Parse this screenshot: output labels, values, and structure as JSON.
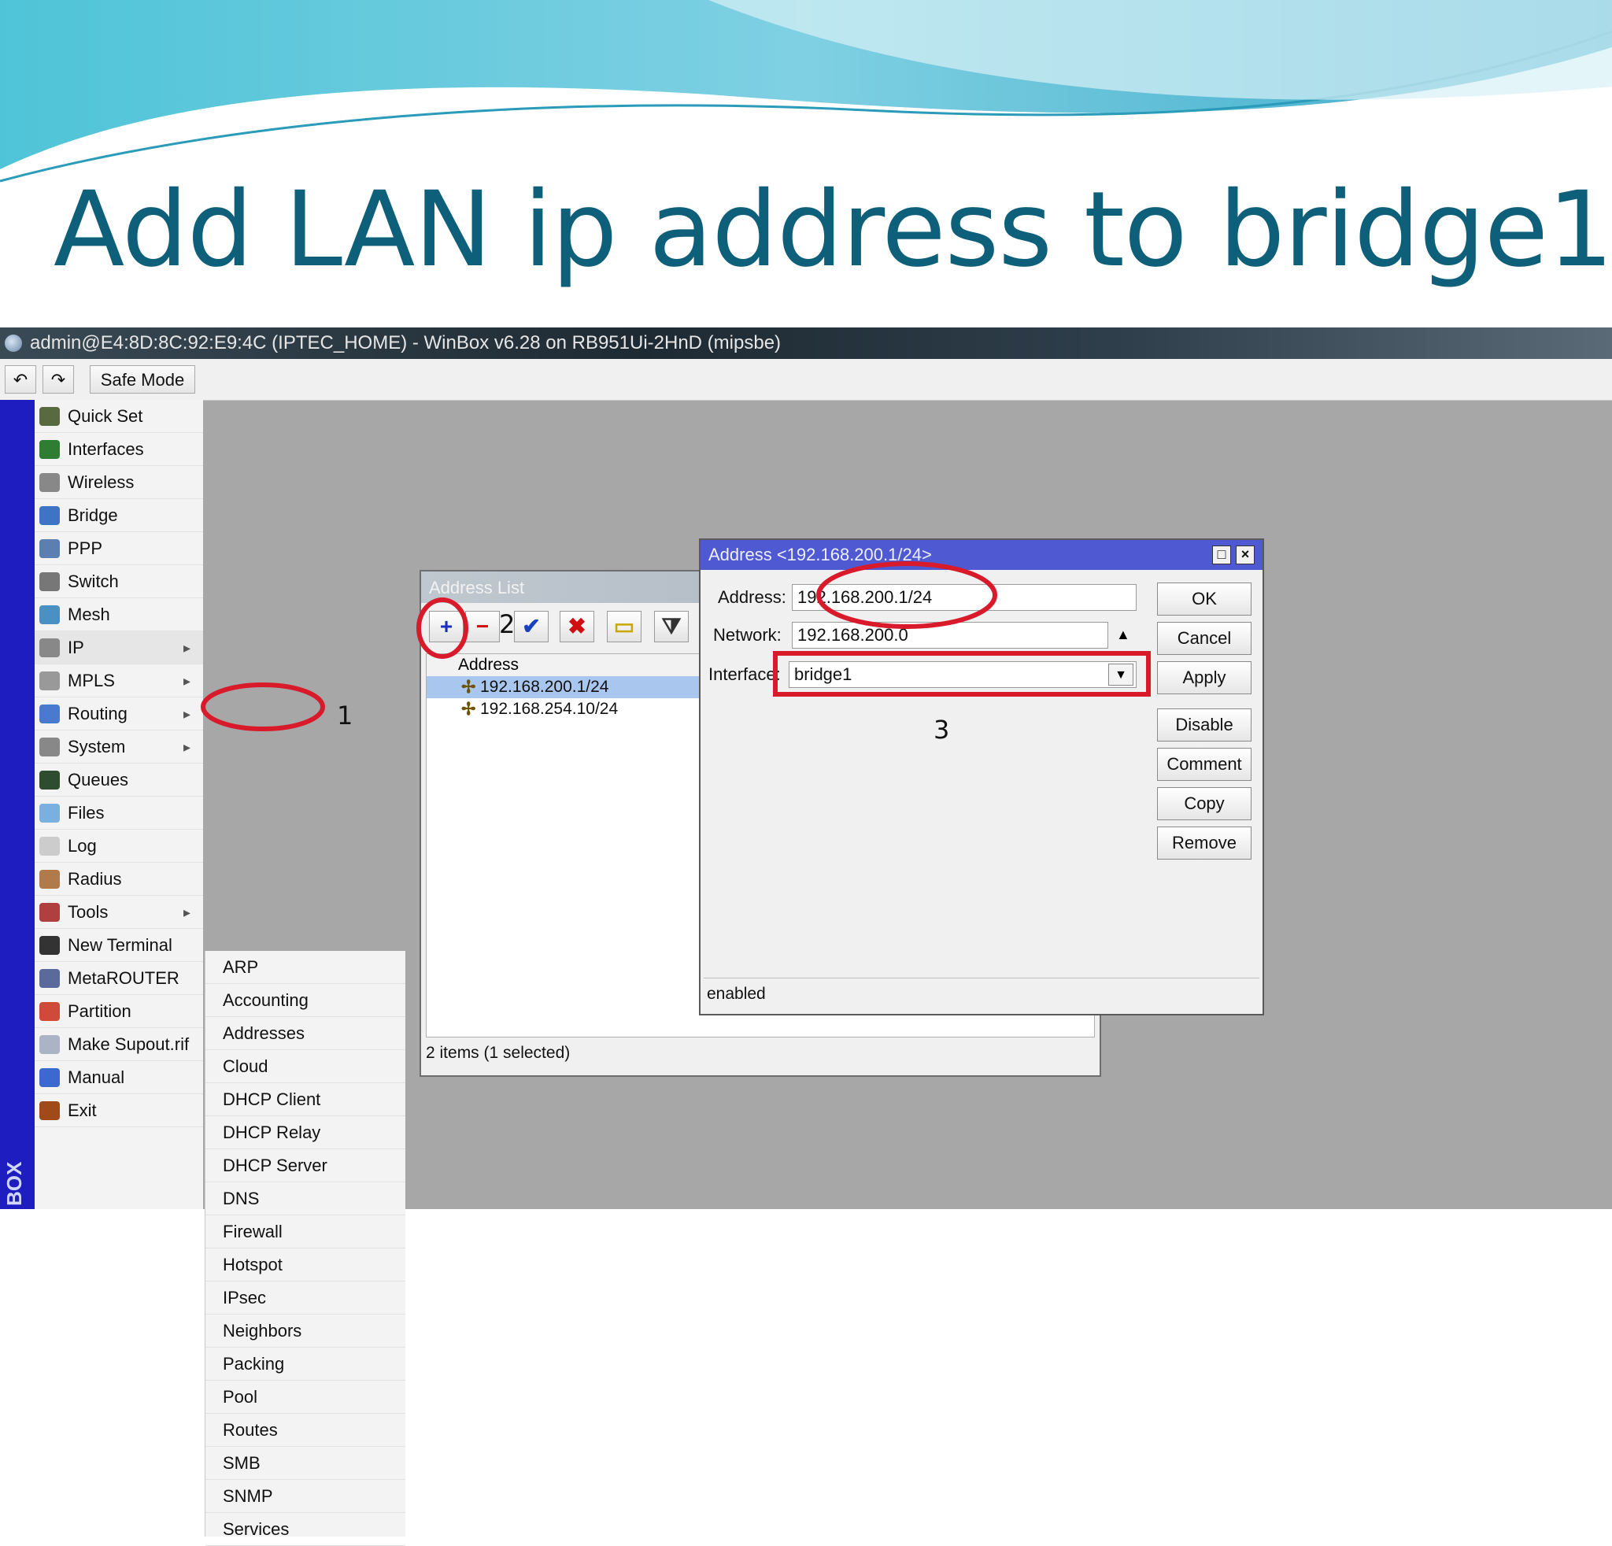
{
  "slide": {
    "title": "Add LAN ip address to bridge1"
  },
  "window": {
    "title": "admin@E4:8D:8C:92:E9:4C (IPTEC_HOME) - WinBox v6.28 on RB951Ui-2HnD (mipsbe)"
  },
  "toolbar": {
    "undo_icon": "undo-icon",
    "redo_icon": "redo-icon",
    "safe_mode_label": "Safe Mode"
  },
  "sidebar": {
    "brand": "BOX",
    "items": [
      {
        "label": "Quick Set",
        "icon": "quick-set-icon",
        "color": "#5a6a40"
      },
      {
        "label": "Interfaces",
        "icon": "interfaces-icon",
        "color": "#2e7d32"
      },
      {
        "label": "Wireless",
        "icon": "wireless-icon",
        "color": "#888888"
      },
      {
        "label": "Bridge",
        "icon": "bridge-icon",
        "color": "#3d74c4"
      },
      {
        "label": "PPP",
        "icon": "ppp-icon",
        "color": "#5a7fb0"
      },
      {
        "label": "Switch",
        "icon": "switch-icon",
        "color": "#777777"
      },
      {
        "label": "Mesh",
        "icon": "mesh-icon",
        "color": "#4a90c2"
      },
      {
        "label": "IP",
        "icon": "ip-icon",
        "color": "#888888",
        "submenu": true
      },
      {
        "label": "MPLS",
        "icon": "mpls-icon",
        "color": "#999999",
        "submenu": true
      },
      {
        "label": "Routing",
        "icon": "routing-icon",
        "color": "#4a7ad0",
        "submenu": true
      },
      {
        "label": "System",
        "icon": "system-icon",
        "color": "#888888",
        "submenu": true
      },
      {
        "label": "Queues",
        "icon": "queues-icon",
        "color": "#2e4d2e"
      },
      {
        "label": "Files",
        "icon": "files-icon",
        "color": "#7ab0e0"
      },
      {
        "label": "Log",
        "icon": "log-icon",
        "color": "#cccccc"
      },
      {
        "label": "Radius",
        "icon": "radius-icon",
        "color": "#b07a4a"
      },
      {
        "label": "Tools",
        "icon": "tools-icon",
        "color": "#b04040",
        "submenu": true
      },
      {
        "label": "New Terminal",
        "icon": "terminal-icon",
        "color": "#333333"
      },
      {
        "label": "MetaROUTER",
        "icon": "metarouter-icon",
        "color": "#5a6a9a"
      },
      {
        "label": "Partition",
        "icon": "partition-icon",
        "color": "#d04a3a"
      },
      {
        "label": "Make Supout.rif",
        "icon": "supout-icon",
        "color": "#aab4c4"
      },
      {
        "label": "Manual",
        "icon": "manual-icon",
        "color": "#3a6ad0"
      },
      {
        "label": "Exit",
        "icon": "exit-icon",
        "color": "#a04a1a"
      }
    ]
  },
  "ip_submenu": {
    "items": [
      "ARP",
      "Accounting",
      "Addresses",
      "Cloud",
      "DHCP Client",
      "DHCP Relay",
      "DHCP Server",
      "DNS",
      "Firewall",
      "Hotspot",
      "IPsec",
      "Neighbors",
      "Packing",
      "Pool",
      "Routes",
      "SMB",
      "SNMP",
      "Services"
    ]
  },
  "address_list": {
    "title": "Address List",
    "buttons": [
      {
        "name": "add-button",
        "icon": "plus-icon",
        "glyph": "+",
        "color": "#1a2fbf"
      },
      {
        "name": "remove-button",
        "icon": "minus-icon",
        "glyph": "−",
        "color": "#d01010"
      },
      {
        "name": "enable-button",
        "icon": "check-icon",
        "glyph": "✔",
        "color": "#1a3fbf"
      },
      {
        "name": "disable-button",
        "icon": "cross-icon",
        "glyph": "✖",
        "color": "#d01010"
      },
      {
        "name": "comment-button",
        "icon": "comment-icon",
        "glyph": "▭",
        "color": "#c9a800"
      },
      {
        "name": "filter-button",
        "icon": "filter-icon",
        "glyph": "⧩",
        "color": "#333333"
      }
    ],
    "column_header": "Address",
    "rows": [
      {
        "address": "192.168.200.1/24",
        "selected": true
      },
      {
        "address": "192.168.254.10/24",
        "selected": false
      }
    ],
    "status": "2 items (1 selected)"
  },
  "address_dialog": {
    "title": "Address <192.168.200.1/24>",
    "fields": {
      "address_label": "Address:",
      "address_value": "192.168.200.1/24",
      "network_label": "Network:",
      "network_value": "192.168.200.0",
      "interface_label": "Interface:",
      "interface_value": "bridge1"
    },
    "buttons": [
      "OK",
      "Cancel",
      "Apply",
      "Disable",
      "Comment",
      "Copy",
      "Remove"
    ],
    "status": "enabled"
  },
  "annotations": {
    "step1": "1",
    "step2": "2",
    "step3": "3",
    "highlight_color": "#d81a2a"
  }
}
